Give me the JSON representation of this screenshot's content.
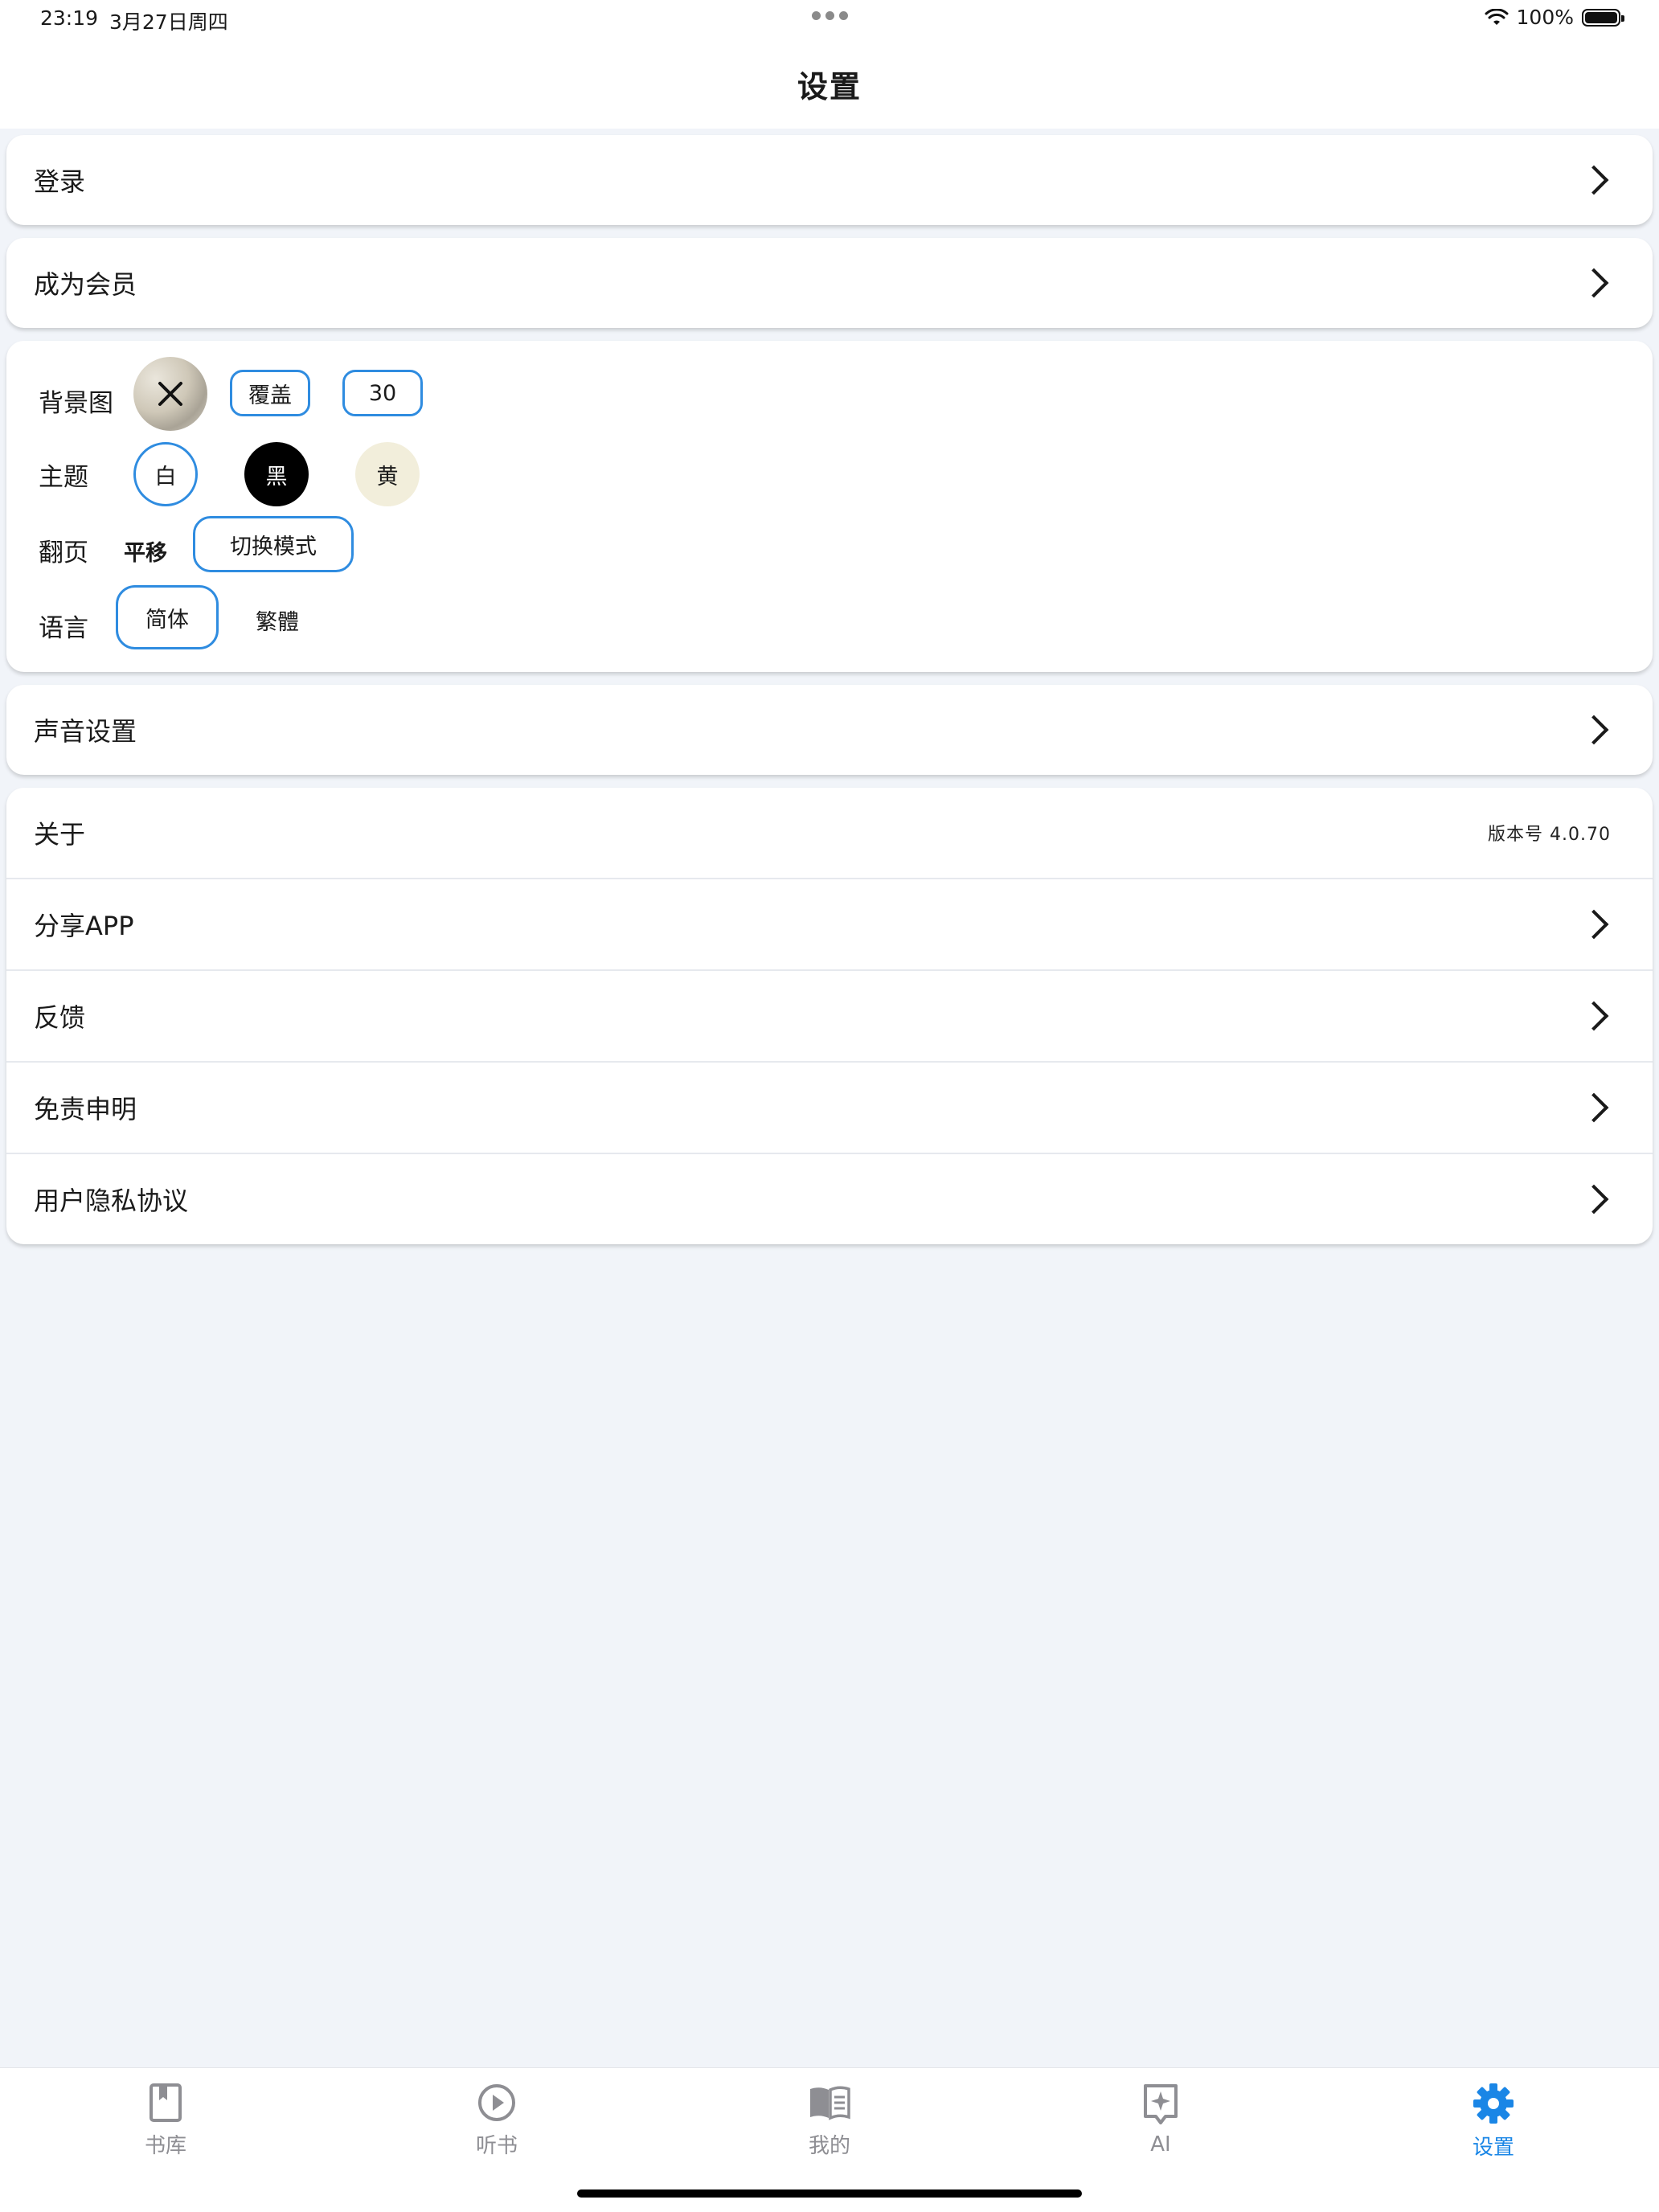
{
  "status_bar": {
    "time": "23:19",
    "date": "3月27日周四",
    "battery_percent": "100%"
  },
  "header": {
    "title": "设置"
  },
  "menu": {
    "login": "登录",
    "membership": "成为会员",
    "sound": "声音设置"
  },
  "settings": {
    "background": {
      "label": "背景图",
      "mode_button": "覆盖",
      "opacity_value": "30"
    },
    "theme": {
      "label": "主题",
      "options": [
        "白",
        "黑",
        "黄"
      ],
      "selected": "白",
      "colors": {
        "white": "#ffffff",
        "black": "#000000",
        "yellow": "#f2eedb"
      }
    },
    "page_turn": {
      "label": "翻页",
      "current": "平移",
      "switch_button": "切换模式"
    },
    "language": {
      "label": "语言",
      "options": [
        "简体",
        "繁體"
      ],
      "selected": "简体"
    }
  },
  "about_group": {
    "about": "关于",
    "version": "版本号 4.0.70",
    "share": "分享APP",
    "feedback": "反馈",
    "disclaimer": "免责申明",
    "privacy": "用户隐私协议"
  },
  "tabbar": {
    "items": [
      {
        "label": "书库",
        "icon": "bookmark-book-icon"
      },
      {
        "label": "听书",
        "icon": "play-circle-icon"
      },
      {
        "label": "我的",
        "icon": "open-book-icon"
      },
      {
        "label": "AI",
        "icon": "ai-sparkle-icon"
      },
      {
        "label": "设置",
        "icon": "gear-icon"
      }
    ],
    "active": "设置",
    "active_color": "#1a86e6",
    "inactive_color": "#8e8e93"
  },
  "accent_color": "#2f8ce0"
}
